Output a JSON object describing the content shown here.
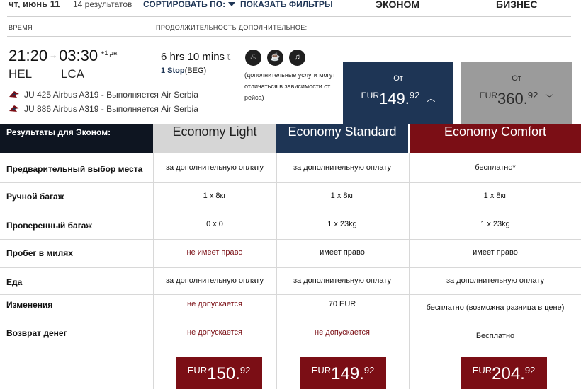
{
  "topbar": {
    "date": "чт, июнь 11",
    "results": "14 результатов",
    "sort_label": "СОРТИРОВАТЬ ПО:",
    "filters_label": "ПОКАЗАТЬ ФИЛЬТРЫ",
    "tab_economy": "ЭКОНОМ",
    "tab_business": "БИЗНЕС"
  },
  "columns": {
    "time": "ВРЕМЯ",
    "duration_extra": "ПРОДОЛЖИТЕЛЬНОСТЬ ДОПОЛНИТЕЛЬНОЕ:"
  },
  "flight": {
    "depart_time": "21:20",
    "arrive_time": "03:30",
    "next_day": "+1 дн.",
    "from": "HEL",
    "to": "LCA",
    "duration": "6 hrs 10 mins",
    "stops": "1 Stop",
    "stop_airport": "(BEG)",
    "segments": [
      {
        "text": "JU 425 Airbus A319 - Выполняется Air Serbia"
      },
      {
        "text": "JU 886 Airbus A319 - Выполняется Air Serbia"
      }
    ],
    "services_note": "(дополнительные услуги могут отличаться в зависимости от рейса)",
    "service_icons": [
      "meal-icon",
      "drink-icon",
      "entertainment-icon"
    ]
  },
  "price_boxes": {
    "economy": {
      "from": "От",
      "currency": "EUR",
      "int": "149.",
      "dec": "92"
    },
    "business": {
      "from": "От",
      "currency": "EUR",
      "int": "360.",
      "dec": "92"
    }
  },
  "table": {
    "header_label": "Результаты для Эконом:",
    "fares": [
      "Economy Light",
      "Economy Standard",
      "Economy Comfort"
    ],
    "rows": [
      {
        "label": "Предварительный выбор места",
        "values": [
          "за дополнительную оплату",
          "за дополнительную оплату",
          "бесплатно*"
        ]
      },
      {
        "label": "Ручной багаж",
        "values": [
          "1 x 8кг",
          "1 x 8кг",
          "1 x 8кг"
        ]
      },
      {
        "label": "Проверенный багаж",
        "values": [
          "0 x 0",
          "1 x 23kg",
          "1 x 23kg"
        ]
      },
      {
        "label": "Пробег в милях",
        "values": [
          "не имеет право",
          "имеет право",
          "имеет право"
        ]
      },
      {
        "label": "Еда",
        "values": [
          "за дополнительную оплату",
          "за дополнительную оплату",
          "за дополнительную оплату"
        ]
      },
      {
        "label": "Изменения",
        "values": [
          "не допускается",
          "70 EUR",
          "бесплатно (возможна разница в цене)"
        ]
      },
      {
        "label": "Возврат денег",
        "values": [
          "не допускается",
          "не допускается",
          "Бесплатно"
        ]
      }
    ],
    "prices": [
      {
        "currency": "EUR",
        "int": "150.",
        "dec": "92"
      },
      {
        "currency": "EUR",
        "int": "149.",
        "dec": "92"
      },
      {
        "currency": "EUR",
        "int": "204.",
        "dec": "92"
      }
    ]
  },
  "colors": {
    "navy": "#1e3555",
    "burgundy": "#7b0e15",
    "grey": "#9b9b9b",
    "dark": "#0e1521"
  }
}
